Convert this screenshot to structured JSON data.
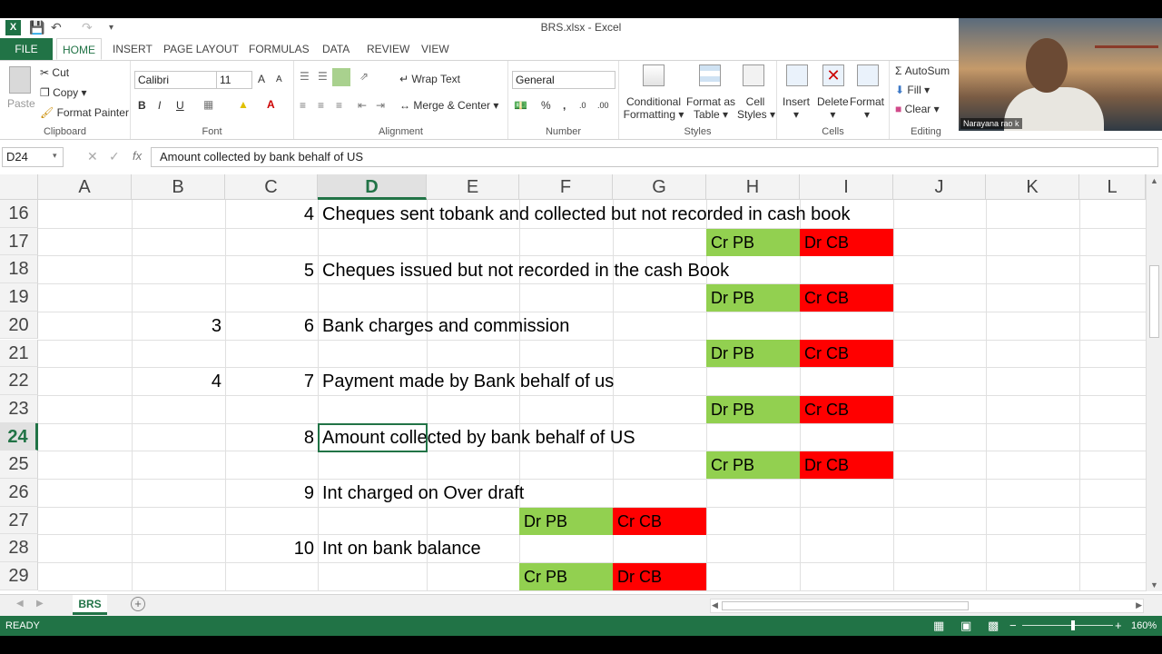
{
  "window": {
    "title": "BRS.xlsx - Excel",
    "app_icon": "X"
  },
  "tabs": [
    "FILE",
    "HOME",
    "INSERT",
    "PAGE LAYOUT",
    "FORMULAS",
    "DATA",
    "REVIEW",
    "VIEW"
  ],
  "ribbon": {
    "clipboard": {
      "paste": "Paste",
      "cut": "Cut",
      "copy": "Copy",
      "format_painter": "Format Painter",
      "label": "Clipboard"
    },
    "font": {
      "name": "Calibri",
      "size": "11",
      "bold": "B",
      "italic": "I",
      "underline": "U",
      "label": "Font"
    },
    "alignment": {
      "wrap": "Wrap Text",
      "merge": "Merge & Center",
      "label": "Alignment"
    },
    "number": {
      "format": "General",
      "percent": "%",
      "comma": ",",
      "label": "Number"
    },
    "styles": {
      "conditional": "Conditional",
      "conditional2": "Formatting",
      "format_table": "Format as",
      "format_table2": "Table",
      "cell_styles": "Cell",
      "cell_styles2": "Styles",
      "label": "Styles"
    },
    "cells": {
      "insert": "Insert",
      "delete": "Delete",
      "format": "Format",
      "label": "Cells"
    },
    "editing": {
      "autosum": "AutoSum",
      "fill": "Fill",
      "clear": "Clear",
      "label": "Editing"
    }
  },
  "webcam": {
    "name": "Narayana rao k"
  },
  "formula_bar": {
    "name_box": "D24",
    "fx": "fx",
    "value": "Amount collected by bank behalf of US"
  },
  "columns": [
    "A",
    "B",
    "C",
    "D",
    "E",
    "F",
    "G",
    "H",
    "I",
    "J",
    "K",
    "L"
  ],
  "selected_column": "D",
  "rows": [
    "16",
    "17",
    "18",
    "19",
    "20",
    "21",
    "22",
    "23",
    "24",
    "25",
    "26",
    "27",
    "28",
    "29"
  ],
  "selected_row": "24",
  "cells": {
    "c16": "4",
    "d16": "Cheques sent tobank and collected but not recorded in cash book",
    "h17": "Cr PB",
    "i17": "Dr CB",
    "c18": "5",
    "d18": "Cheques issued but not recorded in the cash Book",
    "h19": "Dr PB",
    "i19": "Cr CB",
    "b20": "3",
    "c20": "6",
    "d20": "Bank charges and commission",
    "h21": "Dr PB",
    "i21": "Cr CB",
    "b22": "4",
    "c22": "7",
    "d22": "Payment made by Bank behalf of us",
    "h23": "Dr PB",
    "i23": "Cr CB",
    "c24": "8",
    "d24": "Amount collected by bank behalf of US",
    "h25": "Cr PB",
    "i25": "Dr CB",
    "c26": "9",
    "d26": "Int charged on Over draft",
    "f27": "Dr PB",
    "g27": "Cr CB",
    "c28": "10",
    "d28": "Int on bank balance",
    "f29": "Cr PB",
    "g29": "Dr CB"
  },
  "colors": {
    "accent": "#217346",
    "green_fill": "#92d050",
    "red_fill": "#ff0000"
  },
  "sheet_tab": "BRS",
  "status": {
    "ready": "READY",
    "zoom": "160%"
  }
}
